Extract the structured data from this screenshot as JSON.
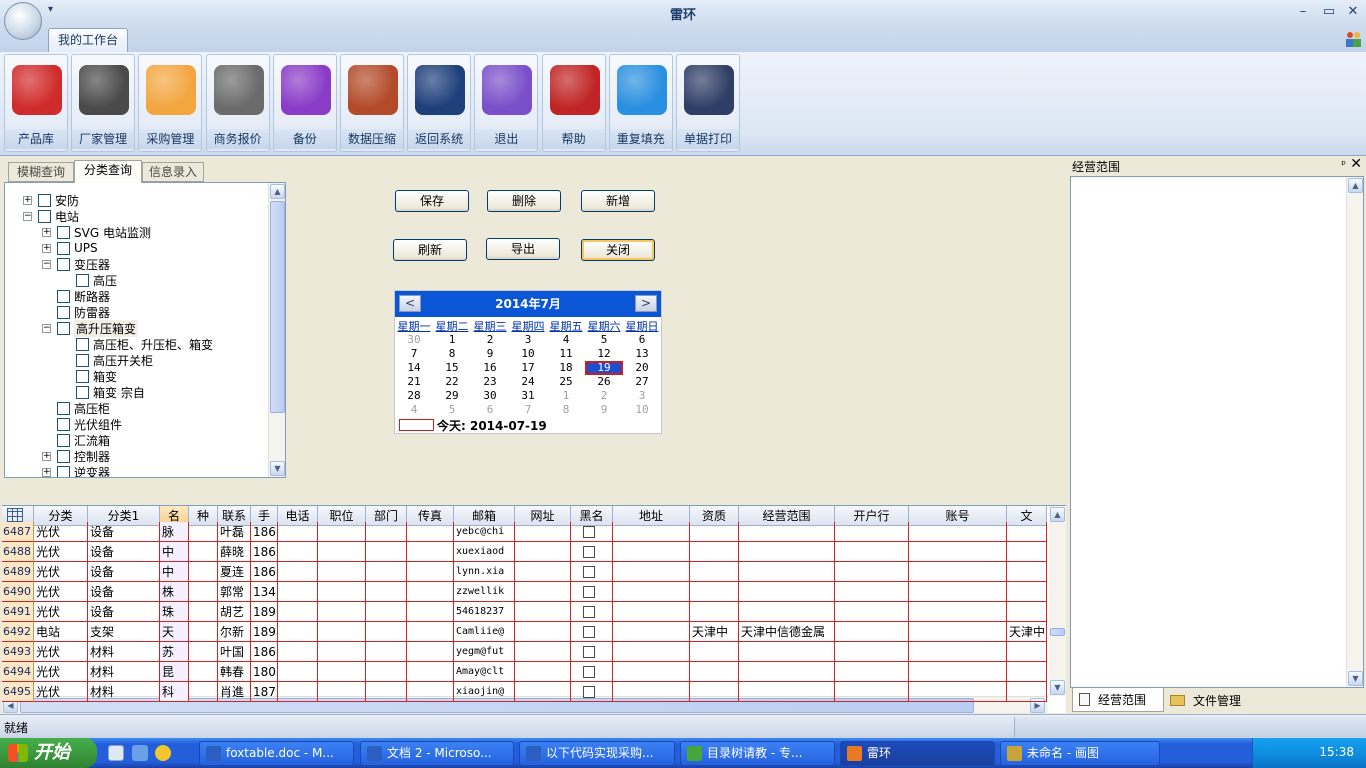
{
  "window": {
    "title": "雷环",
    "quick_access": "▾",
    "min": "–",
    "max": "▭",
    "close": "✕"
  },
  "ribbon": {
    "tab": "我的工作台",
    "buttons": [
      {
        "label": "产品库",
        "icon": "product-library-icon",
        "color": "#d02b2b"
      },
      {
        "label": "厂家管理",
        "icon": "manufacturer-tools-icon",
        "color": "#4a4a4a"
      },
      {
        "label": "采购管理",
        "icon": "purchase-weather-icon",
        "color": "#f3a640"
      },
      {
        "label": "商务报价",
        "icon": "calculator-icon",
        "color": "#6b6b6b"
      },
      {
        "label": "备份",
        "icon": "disc-icon",
        "color": "#8a3bc7"
      },
      {
        "label": "数据压缩",
        "icon": "mail-compress-icon",
        "color": "#b34a2a"
      },
      {
        "label": "返回系统",
        "icon": "monitor-icon",
        "color": "#1d3f7a"
      },
      {
        "label": "退出",
        "icon": "download-exit-icon",
        "color": "#7a4fc9"
      },
      {
        "label": "帮助",
        "icon": "help-person-icon",
        "color": "#c02424"
      },
      {
        "label": "重复填充",
        "icon": "compass-icon",
        "color": "#2a8fe0"
      },
      {
        "label": "单据打印",
        "icon": "print-app-icon",
        "color": "#2f3e66"
      }
    ]
  },
  "left_tabs": [
    "模糊查询",
    "分类查询",
    "信息录入"
  ],
  "tree": [
    {
      "label": "安防",
      "level": 0,
      "exp": "+"
    },
    {
      "label": "电站",
      "level": 0,
      "exp": "−"
    },
    {
      "label": "SVG  电站监测",
      "level": 1,
      "exp": "+"
    },
    {
      "label": "UPS",
      "level": 1,
      "exp": "+"
    },
    {
      "label": "变压器",
      "level": 1,
      "exp": "−"
    },
    {
      "label": "高压",
      "level": 2,
      "exp": ""
    },
    {
      "label": "断路器",
      "level": 1,
      "exp": ""
    },
    {
      "label": "防雷器",
      "level": 1,
      "exp": ""
    },
    {
      "label": "高升压箱变",
      "level": 1,
      "exp": "−"
    },
    {
      "label": "高压柜、升压柜、箱变",
      "level": 2,
      "exp": ""
    },
    {
      "label": "高压开关柜",
      "level": 2,
      "exp": ""
    },
    {
      "label": "箱变",
      "level": 2,
      "exp": ""
    },
    {
      "label": "箱变 宗自",
      "level": 2,
      "exp": ""
    },
    {
      "label": "高压柜",
      "level": 1,
      "exp": ""
    },
    {
      "label": "光伏组件",
      "level": 1,
      "exp": ""
    },
    {
      "label": "汇流箱",
      "level": 1,
      "exp": ""
    },
    {
      "label": "控制器",
      "level": 1,
      "exp": "+"
    },
    {
      "label": "逆变器",
      "level": 1,
      "exp": "+"
    }
  ],
  "buttons": {
    "save": "保存",
    "delete": "删除",
    "add": "新增",
    "refresh": "刷新",
    "export": "导出",
    "close": "关闭"
  },
  "calendar": {
    "title": "2014年7月",
    "prev": "<",
    "next": ">",
    "dow": [
      "星期一",
      "星期二",
      "星期三",
      "星期四",
      "星期五",
      "星期六",
      "星期日"
    ],
    "weeks": [
      [
        [
          "30",
          1
        ],
        [
          "1",
          0
        ],
        [
          "2",
          0
        ],
        [
          "3",
          0
        ],
        [
          "4",
          0
        ],
        [
          "5",
          0
        ],
        [
          "6",
          0
        ]
      ],
      [
        [
          "7",
          0
        ],
        [
          "8",
          0
        ],
        [
          "9",
          0
        ],
        [
          "10",
          0
        ],
        [
          "11",
          0
        ],
        [
          "12",
          0
        ],
        [
          "13",
          0
        ]
      ],
      [
        [
          "14",
          0
        ],
        [
          "15",
          0
        ],
        [
          "16",
          0
        ],
        [
          "17",
          0
        ],
        [
          "18",
          0
        ],
        [
          "19",
          2
        ],
        [
          "20",
          0
        ]
      ],
      [
        [
          "21",
          0
        ],
        [
          "22",
          0
        ],
        [
          "23",
          0
        ],
        [
          "24",
          0
        ],
        [
          "25",
          0
        ],
        [
          "26",
          0
        ],
        [
          "27",
          0
        ]
      ],
      [
        [
          "28",
          0
        ],
        [
          "29",
          0
        ],
        [
          "30",
          0
        ],
        [
          "31",
          0
        ],
        [
          "1",
          1
        ],
        [
          "2",
          1
        ],
        [
          "3",
          1
        ]
      ],
      [
        [
          "4",
          1
        ],
        [
          "5",
          1
        ],
        [
          "6",
          1
        ],
        [
          "7",
          1
        ],
        [
          "8",
          1
        ],
        [
          "9",
          1
        ],
        [
          "10",
          1
        ]
      ]
    ],
    "today": "今天: 2014-07-19"
  },
  "grid": {
    "columns": [
      "",
      "分类",
      "分类1",
      "名",
      "种",
      "联系",
      "手",
      "电话",
      "职位",
      "部门",
      "传真",
      "邮箱",
      "网址",
      "黑名",
      "地址",
      "资质",
      "经营范围",
      "开户行",
      "账号",
      "文"
    ],
    "rows": [
      [
        "6487",
        "光伏",
        "设备",
        "脉",
        "",
        "叶磊",
        "186",
        "",
        "",
        "",
        "",
        "yebc@chi",
        "",
        "",
        "",
        "",
        "",
        "",
        "",
        ""
      ],
      [
        "6488",
        "光伏",
        "设备",
        "中",
        "",
        "薛晓",
        "186",
        "",
        "",
        "",
        "",
        "xuexiaod",
        "",
        "",
        "",
        "",
        "",
        "",
        "",
        ""
      ],
      [
        "6489",
        "光伏",
        "设备",
        "中",
        "",
        "夏连",
        "186",
        "",
        "",
        "",
        "",
        "lynn.xia",
        "",
        "",
        "",
        "",
        "",
        "",
        "",
        ""
      ],
      [
        "6490",
        "光伏",
        "设备",
        "株",
        "",
        "郭常",
        "134",
        "",
        "",
        "",
        "",
        "zzwellik",
        "",
        "",
        "",
        "",
        "",
        "",
        "",
        ""
      ],
      [
        "6491",
        "光伏",
        "设备",
        "珠",
        "",
        "胡艺",
        "189",
        "",
        "",
        "",
        "",
        "54618237",
        "",
        "",
        "",
        "",
        "",
        "",
        "",
        ""
      ],
      [
        "6492",
        "电站",
        "支架",
        "天",
        "",
        "尔新",
        "189",
        "",
        "",
        "",
        "",
        "Camliie@",
        "",
        "",
        "",
        "天津中",
        "天津中信德金属",
        "",
        "",
        "天津中"
      ],
      [
        "6493",
        "光伏",
        "材料",
        "苏",
        "",
        "叶国",
        "186",
        "",
        "",
        "",
        "",
        "yegm@fut",
        "",
        "",
        "",
        "",
        "",
        "",
        "",
        ""
      ],
      [
        "6494",
        "光伏",
        "材料",
        "昆",
        "",
        "韩春",
        "180",
        "",
        "",
        "",
        "",
        "Amay@clt",
        "",
        "",
        "",
        "",
        "",
        "",
        "",
        ""
      ],
      [
        "6495",
        "光伏",
        "材料",
        "科",
        "",
        "肖進",
        "187",
        "",
        "",
        "",
        "",
        "xiaojin@",
        "",
        "",
        "",
        "",
        "",
        "",
        "",
        ""
      ]
    ]
  },
  "right_panel": {
    "title": "经营范围",
    "pin": "ᵖ",
    "close": "✕",
    "tabs": [
      "经营范围",
      "文件管理"
    ]
  },
  "status": "就绪",
  "taskbar": {
    "start": "开始",
    "items": [
      {
        "label": "foxtable.doc - M...",
        "color": "#2b5fbf"
      },
      {
        "label": "文档 2 - Microso...",
        "color": "#2b5fbf"
      },
      {
        "label": "以下代码实现采购...",
        "color": "#2b5fbf"
      },
      {
        "label": "目录树请教 - 专...",
        "color": "#48a43c"
      },
      {
        "label": "雷环",
        "color": "#e87a24"
      },
      {
        "label": "未命名 - 画图",
        "color": "#c8a43a"
      }
    ],
    "clock": "15:38"
  }
}
